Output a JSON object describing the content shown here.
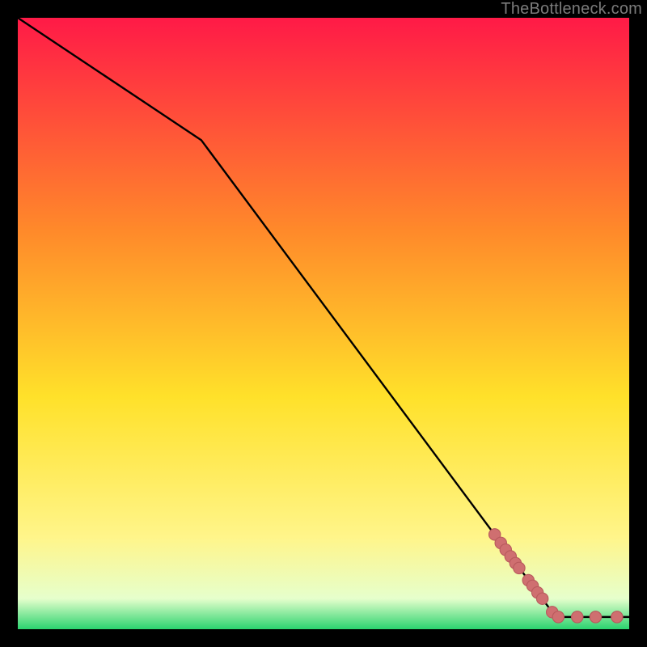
{
  "watermark": "TheBottleneck.com",
  "colors": {
    "gradient_top": "#ff1a47",
    "gradient_upper_mid": "#ff8a2a",
    "gradient_mid": "#ffe12a",
    "gradient_lower_mid": "#fff58a",
    "gradient_near_bottom": "#e6ffcc",
    "gradient_bottom": "#2bd36f",
    "line": "#000000",
    "marker": "#cf6f70",
    "marker_stroke": "#b95a5d"
  },
  "chart_data": {
    "type": "line",
    "title": "",
    "xlabel": "",
    "ylabel": "",
    "xlim": [
      0,
      100
    ],
    "ylim": [
      0,
      100
    ],
    "series": [
      {
        "name": "curve",
        "x": [
          0,
          30,
          88,
          100
        ],
        "y": [
          100,
          80,
          2,
          2
        ]
      }
    ],
    "markers": [
      {
        "x": 78.0,
        "y": 15.5
      },
      {
        "x": 79.0,
        "y": 14.1
      },
      {
        "x": 79.8,
        "y": 13.0
      },
      {
        "x": 80.6,
        "y": 11.9
      },
      {
        "x": 81.4,
        "y": 10.8
      },
      {
        "x": 82.0,
        "y": 10.0
      },
      {
        "x": 83.5,
        "y": 8.0
      },
      {
        "x": 84.2,
        "y": 7.1
      },
      {
        "x": 85.0,
        "y": 6.0
      },
      {
        "x": 85.8,
        "y": 5.0
      },
      {
        "x": 87.4,
        "y": 2.8
      },
      {
        "x": 88.4,
        "y": 2.0
      },
      {
        "x": 91.5,
        "y": 2.0
      },
      {
        "x": 94.5,
        "y": 2.0
      },
      {
        "x": 98.0,
        "y": 2.0
      }
    ]
  }
}
